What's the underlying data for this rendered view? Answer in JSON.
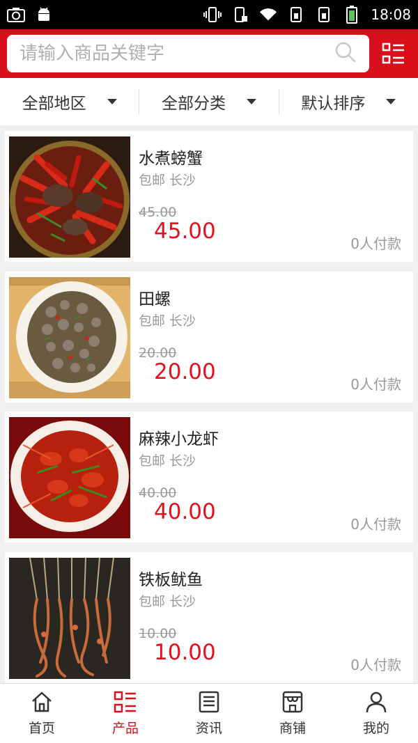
{
  "status": {
    "time": "18:08"
  },
  "search": {
    "placeholder": "请输入商品关键字"
  },
  "filters": [
    {
      "label": "全部地区"
    },
    {
      "label": "全部分类"
    },
    {
      "label": "默认排序"
    }
  ],
  "products": [
    {
      "title": "水煮螃蟹",
      "meta": "包邮 长沙",
      "old_price": "45.00",
      "price": "45.00",
      "paid": "0人付款"
    },
    {
      "title": "田螺",
      "meta": "包邮 长沙",
      "old_price": "20.00",
      "price": "20.00",
      "paid": "0人付款"
    },
    {
      "title": "麻辣小龙虾",
      "meta": "包邮 长沙",
      "old_price": "40.00",
      "price": "40.00",
      "paid": "0人付款"
    },
    {
      "title": "铁板鱿鱼",
      "meta": "包邮 长沙",
      "old_price": "10.00",
      "price": "10.00",
      "paid": "0人付款"
    }
  ],
  "nav": [
    {
      "label": "首页",
      "icon": "home-icon"
    },
    {
      "label": "产品",
      "icon": "products-icon"
    },
    {
      "label": "资讯",
      "icon": "news-icon"
    },
    {
      "label": "商铺",
      "icon": "store-icon"
    },
    {
      "label": "我的",
      "icon": "profile-icon"
    }
  ],
  "colors": {
    "brand": "#d9101c",
    "price": "#e2111e"
  }
}
